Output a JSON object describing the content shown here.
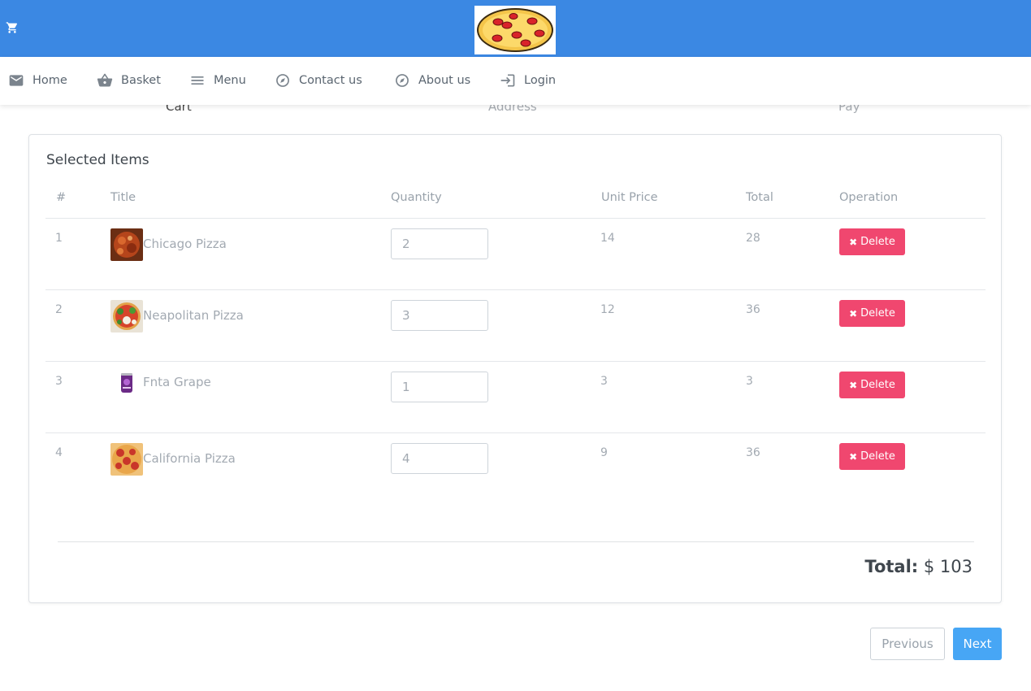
{
  "colors": {
    "topbar": "#3b88e3",
    "delete": "#f0476f",
    "next": "#47a6f5"
  },
  "header": {
    "cart_icon": "shopping-cart-icon",
    "logo_icon": "pizza-logo"
  },
  "nav": [
    {
      "label": "Home",
      "icon": "mail-icon"
    },
    {
      "label": "Basket",
      "icon": "basket-icon"
    },
    {
      "label": "Menu",
      "icon": "menu-icon"
    },
    {
      "label": "Contact us",
      "icon": "compass-icon"
    },
    {
      "label": "About us",
      "icon": "compass-icon"
    },
    {
      "label": "Login",
      "icon": "login-icon"
    }
  ],
  "steps": [
    "Cart",
    "Address",
    "Pay"
  ],
  "card": {
    "title": "Selected Items",
    "columns": [
      "#",
      "Title",
      "Quantity",
      "Unit Price",
      "Total",
      "Operation"
    ],
    "rows": [
      {
        "index": "1",
        "title": "Chicago Pizza",
        "quantity": "2",
        "unit_price": "14",
        "total": "28",
        "operation": "Delete"
      },
      {
        "index": "2",
        "title": "Neapolitan Pizza",
        "quantity": "3",
        "unit_price": "12",
        "total": "36",
        "operation": "Delete"
      },
      {
        "index": "3",
        "title": "Fnta Grape",
        "quantity": "1",
        "unit_price": "3",
        "total": "3",
        "operation": "Delete"
      },
      {
        "index": "4",
        "title": "California Pizza",
        "quantity": "4",
        "unit_price": "9",
        "total": "36",
        "operation": "Delete"
      }
    ],
    "total_label": "Total:",
    "total_value": "$ 103"
  },
  "buttons": {
    "previous": "Previous",
    "next": "Next"
  }
}
